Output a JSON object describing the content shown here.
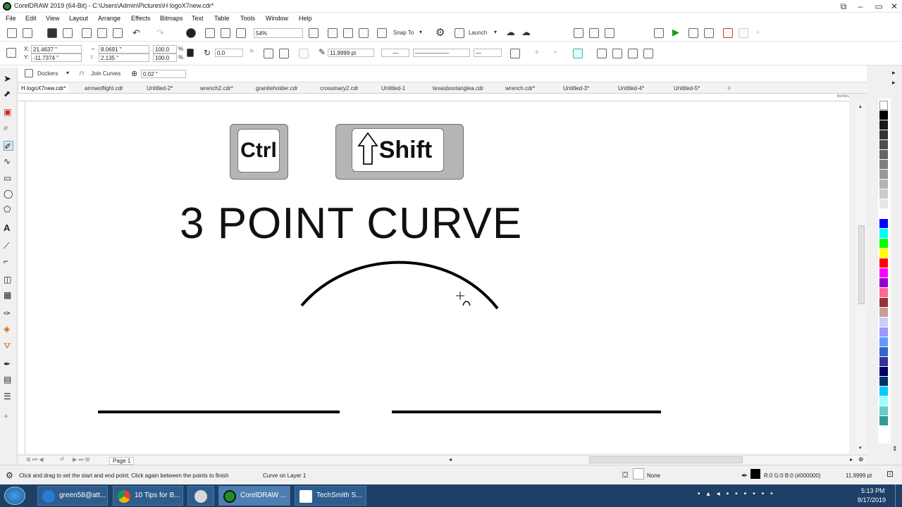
{
  "window": {
    "title": "CorelDRAW 2019 (64-Bit) - C:\\Users\\Admin\\Pictures\\H logoX7new.cdr*",
    "controls": [
      "–",
      "▭",
      "✕"
    ]
  },
  "menu": [
    "File",
    "Edit",
    "View",
    "Layout",
    "Arrange",
    "Effects",
    "Bitmaps",
    "Text",
    "Table",
    "Tools",
    "Window",
    "Help"
  ],
  "toolbar": {
    "zoom": "54%",
    "snap_to": "Snap To",
    "launch": "Launch"
  },
  "property_bar": {
    "x": "21.4637 \"",
    "y": "-11.7374 \"",
    "w": "8.0691 \"",
    "h": "2.135 \"",
    "scale_x": "100.0",
    "scale_y": "100.0",
    "pct1": "%",
    "pct2": "%",
    "rotation": "0.0",
    "outline_width": "11.9999 pt"
  },
  "property_bar2": {
    "dockers": "Dockers",
    "join_curves": "Join Curves",
    "join_value": "0.02 \""
  },
  "document_tabs": [
    {
      "label": "H logoX7new.cdr*",
      "active": true
    },
    {
      "label": "arrowoflight.cdr",
      "active": false
    },
    {
      "label": "Untitled-2*",
      "active": false
    },
    {
      "label": "wrench2.cdr*",
      "active": false
    },
    {
      "label": "graniteholder.cdr",
      "active": false
    },
    {
      "label": "crossmary2.cdr",
      "active": false
    },
    {
      "label": "Untitled-1",
      "active": false
    },
    {
      "label": "texasbootanglea.cdr",
      "active": false
    },
    {
      "label": "wrench.cdr*",
      "active": false
    },
    {
      "label": "Untitled-3*",
      "active": false
    },
    {
      "label": "Untitled-4*",
      "active": false
    },
    {
      "label": "Untitled-5*",
      "active": false
    }
  ],
  "ruler_unit": "inches",
  "canvas": {
    "key_ctrl": "Ctrl",
    "key_shift": "Shift",
    "headline": "3 POINT CURVE"
  },
  "page_nav": {
    "of": "of",
    "page_label": "Page 1"
  },
  "status": {
    "hint": "Click and drag to set the start and end point; Click again between the points to finish",
    "object": "Curve on Layer 1",
    "fill": "None",
    "outline_color": "R:0 G:0 B:0 (#000000)",
    "outline_width": "11.9999 pt"
  },
  "palette": [
    "#ffffff",
    "#000000",
    "#1a1a1a",
    "#333333",
    "#4d4d4d",
    "#666666",
    "#808080",
    "#999999",
    "#b3b3b3",
    "#cccccc",
    "#e6e6e6",
    "#ffffff",
    "#0000ff",
    "#00ffff",
    "#00ff00",
    "#ffff00",
    "#ff0000",
    "#ff00ff",
    "#9900cc",
    "#ff6699",
    "#993333",
    "#cc9999",
    "#ccccff",
    "#9999ff",
    "#6699ff",
    "#3366cc",
    "#333399",
    "#000066",
    "#003366",
    "#00ccff",
    "#99ffff",
    "#66cccc",
    "#339999"
  ],
  "taskbar": {
    "items": [
      {
        "label": "green58@att...",
        "icon": "ie-icon"
      },
      {
        "label": "10 Tips for B...",
        "icon": "chrome-icon"
      },
      {
        "label": "",
        "icon": "app-icon"
      },
      {
        "label": "CorelDRAW ...",
        "icon": "coreldraw-icon"
      },
      {
        "label": "TechSmith S...",
        "icon": "techsmith-icon"
      }
    ],
    "time": "5:13 PM",
    "date": "8/17/2019"
  }
}
